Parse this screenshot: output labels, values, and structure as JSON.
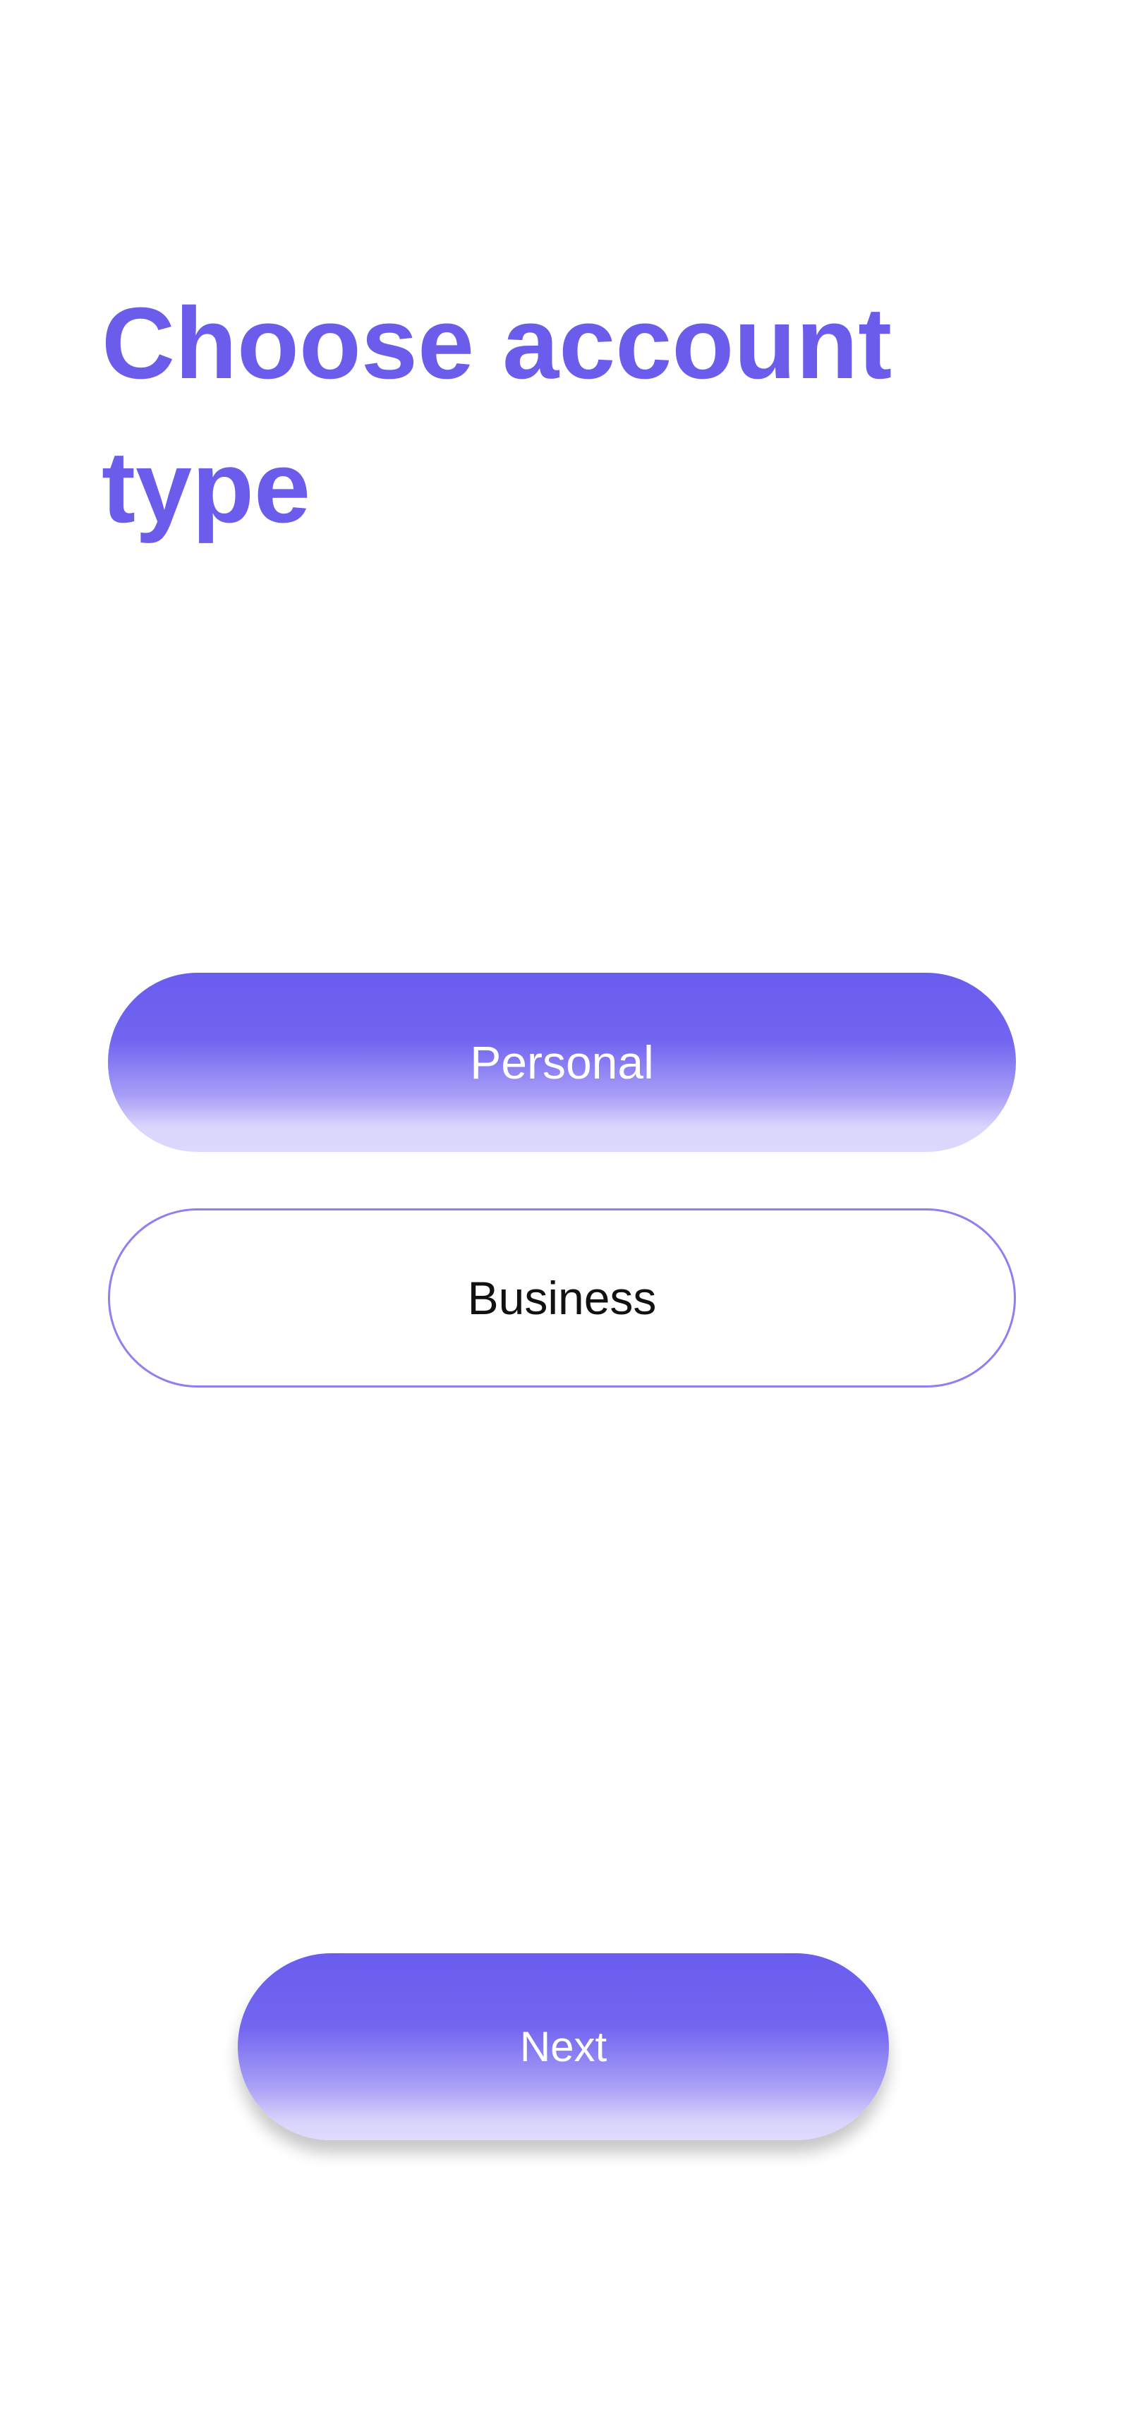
{
  "screen": {
    "title": "Choose account type",
    "accent_color": "#6b5cec"
  },
  "account_types": {
    "options": [
      {
        "label": "Personal",
        "selected": true
      },
      {
        "label": "Business",
        "selected": false
      }
    ]
  },
  "actions": {
    "next_label": "Next"
  }
}
